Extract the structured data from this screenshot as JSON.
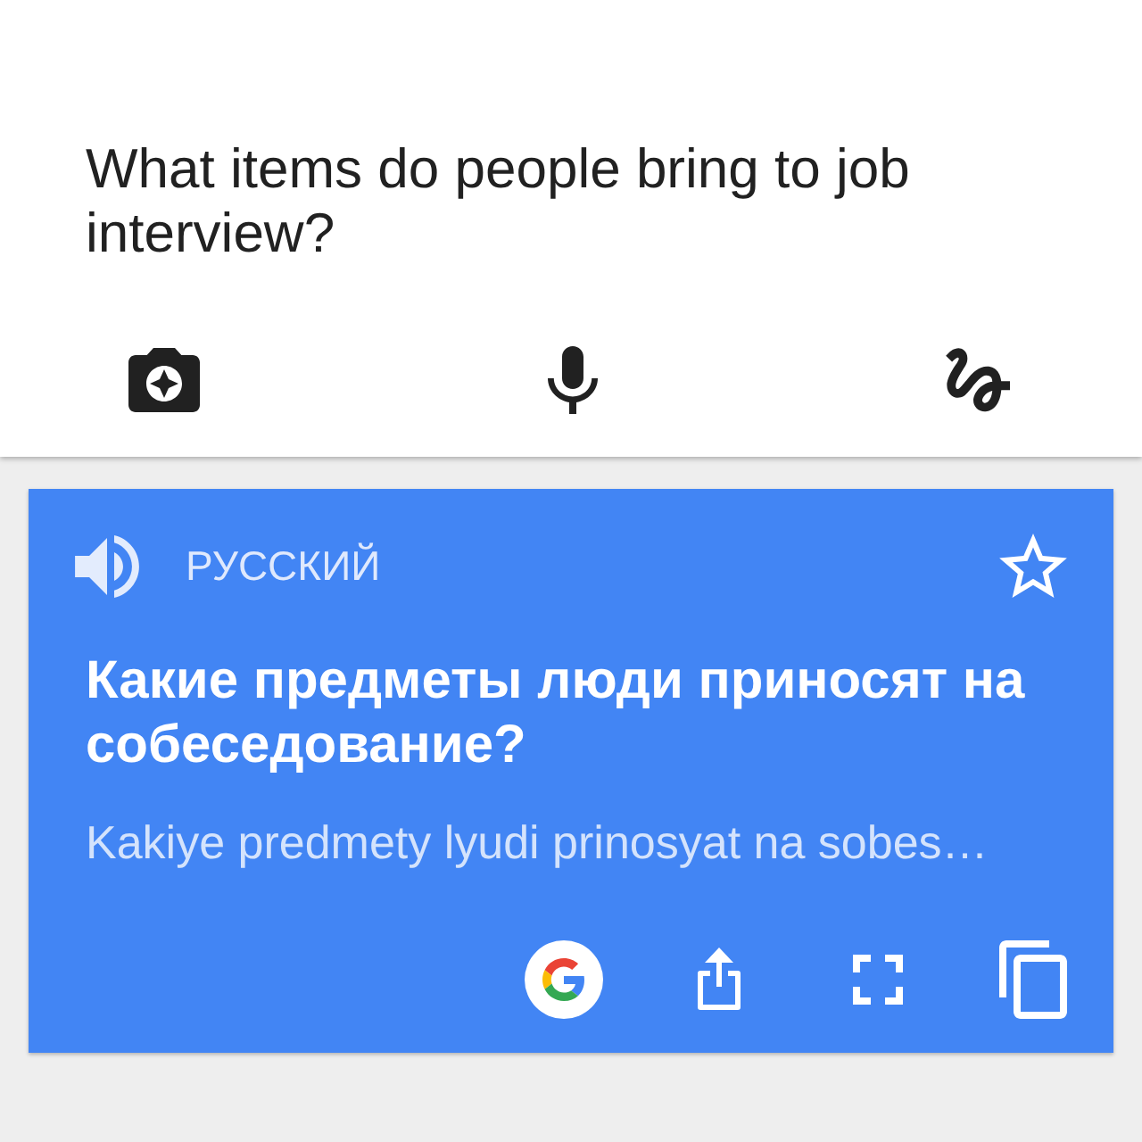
{
  "source_field": {
    "value": "What items do people bring to job interview?"
  },
  "card": {
    "language": "РУССКИЙ",
    "starred": false,
    "translation": "Какие предметы люди приносят на собеседование?",
    "transliteration": "Kakiye predmety lyudi prinosyat na sobes…"
  }
}
